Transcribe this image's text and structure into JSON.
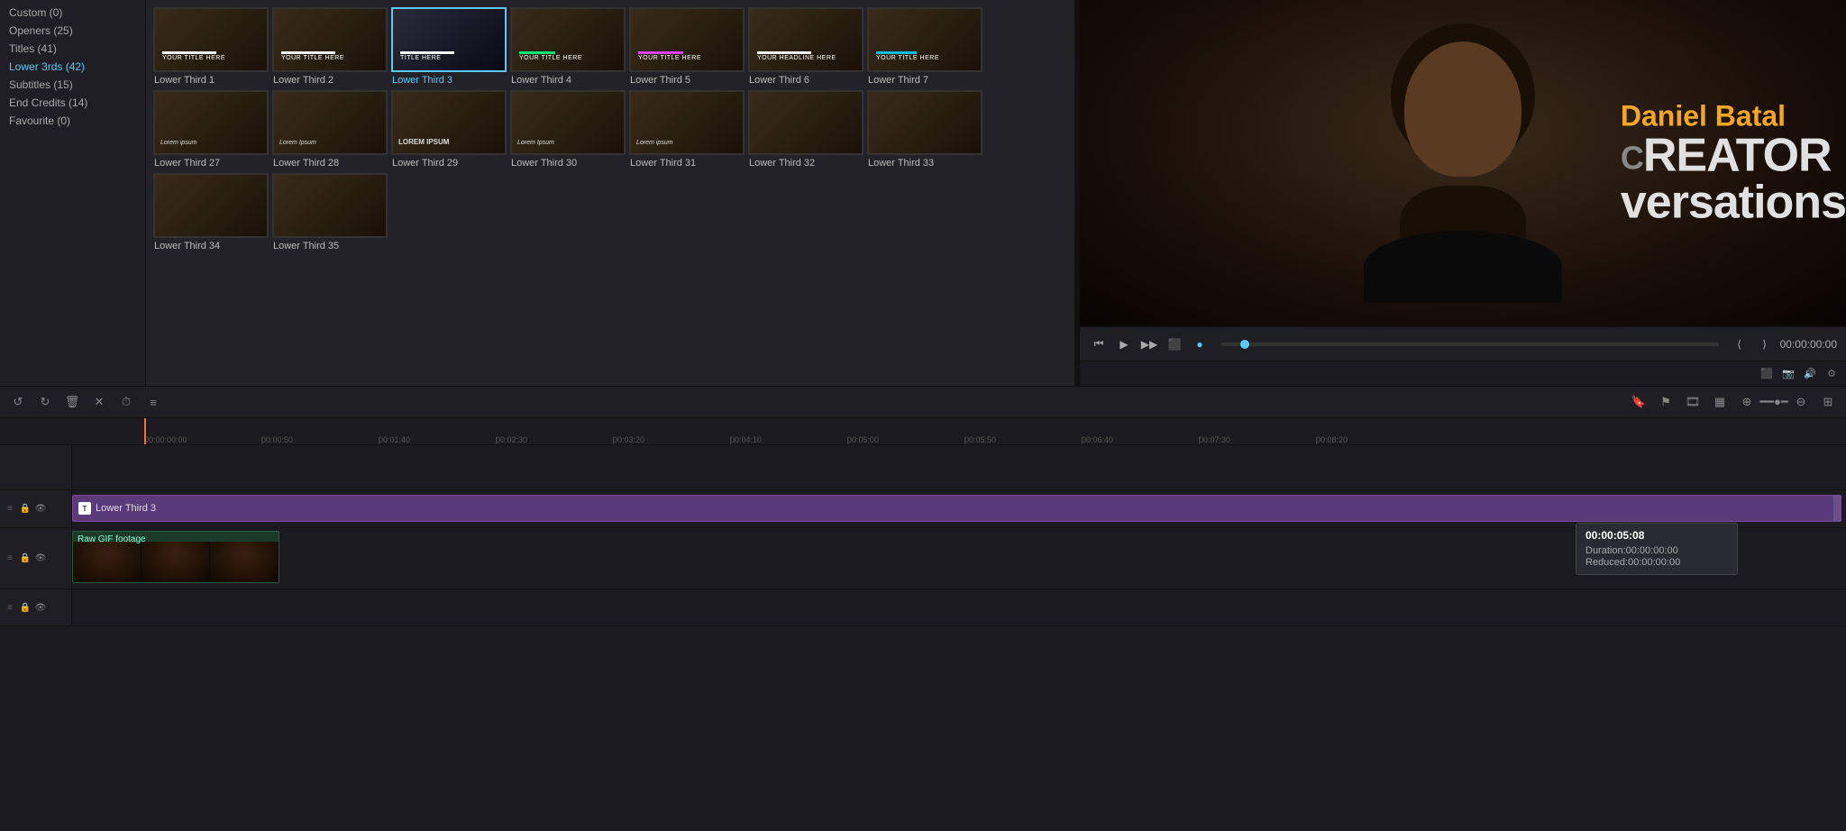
{
  "sidebar": {
    "items": [
      {
        "label": "Custom (0)",
        "active": false
      },
      {
        "label": "Openers (25)",
        "active": false
      },
      {
        "label": "Titles (41)",
        "active": false
      },
      {
        "label": "Lower 3rds (42)",
        "active": true
      },
      {
        "label": "Subtitles (15)",
        "active": false
      },
      {
        "label": "End Credits (14)",
        "active": false
      },
      {
        "label": "Favourite (0)",
        "active": false
      }
    ]
  },
  "grid": {
    "items": [
      {
        "name": "Lower Third 1",
        "bar": "white",
        "label": "YOUR TITLE HERE"
      },
      {
        "name": "Lower Third 2",
        "bar": "white",
        "label": "YOUR TITLE HERE"
      },
      {
        "name": "Lower Third 3",
        "bar": "white",
        "label": "TITLE HERE",
        "selected": true
      },
      {
        "name": "Lower Third 4",
        "bar": "green",
        "label": "YOUR TITLE HERE"
      },
      {
        "name": "Lower Third 5",
        "bar": "pink",
        "label": "YOUR TITLE HERE"
      },
      {
        "name": "Lower Third 6",
        "bar": "white",
        "label": "YOUR HEADLINE HERE"
      },
      {
        "name": "Lower Third 7",
        "bar": "teal",
        "label": "YOUR TITLE HERE"
      },
      {
        "name": "Lower Third 27",
        "bar": "none",
        "label": "Lorem ipsum"
      },
      {
        "name": "Lower Third 28",
        "bar": "none",
        "label": "Lorem Ipsum"
      },
      {
        "name": "Lower Third 29",
        "bar": "none",
        "label": "LOREM IPSUM"
      },
      {
        "name": "Lower Third 30",
        "bar": "none",
        "label": "Lorem Ipsum"
      },
      {
        "name": "Lower Third 31",
        "bar": "none",
        "label": "Lorem ipsum"
      },
      {
        "name": "Lower Third 32",
        "bar": "none",
        "label": ""
      },
      {
        "name": "Lower Third 33",
        "bar": "none",
        "label": ""
      },
      {
        "name": "Lower Third 34",
        "bar": "none",
        "label": ""
      },
      {
        "name": "Lower Third 35",
        "bar": "none",
        "label": ""
      }
    ]
  },
  "preview": {
    "overlay_name": "Daniel Batal",
    "overlay_line1": "REATOR",
    "overlay_line2": "versations",
    "time": "00:00:00:00",
    "toolbar_icons": [
      "monitor",
      "camera",
      "volume",
      "settings"
    ]
  },
  "toolbar": {
    "icons": [
      "undo",
      "redo",
      "delete",
      "close",
      "clock",
      "list"
    ]
  },
  "timeline": {
    "ruler_marks": [
      {
        "time": "00:00:00:00",
        "pos": 0
      },
      {
        "time": "00:00:50",
        "pos": 133
      },
      {
        "time": "00:01:40",
        "pos": 266
      },
      {
        "time": "00:02:30",
        "pos": 399
      },
      {
        "time": "00:03:20",
        "pos": 532
      },
      {
        "time": "00:04:10",
        "pos": 665
      },
      {
        "time": "00:05:00",
        "pos": 798
      },
      {
        "time": "00:05:50",
        "pos": 931
      },
      {
        "time": "00:06:40",
        "pos": 1064
      },
      {
        "time": "00:07:30",
        "pos": 1197
      },
      {
        "time": "00:08:20",
        "pos": 1330
      }
    ],
    "lower_third_track": {
      "label": "Lower Third 3",
      "icon": "T"
    },
    "raw_gif_track": {
      "label": "Raw GIF footage"
    },
    "tooltip": {
      "time": "00:00:05:08",
      "duration_label": "Duration:",
      "duration_value": "00:00:00:00",
      "reduced_label": "Reduced:",
      "reduced_value": "00:00:00:00"
    }
  }
}
